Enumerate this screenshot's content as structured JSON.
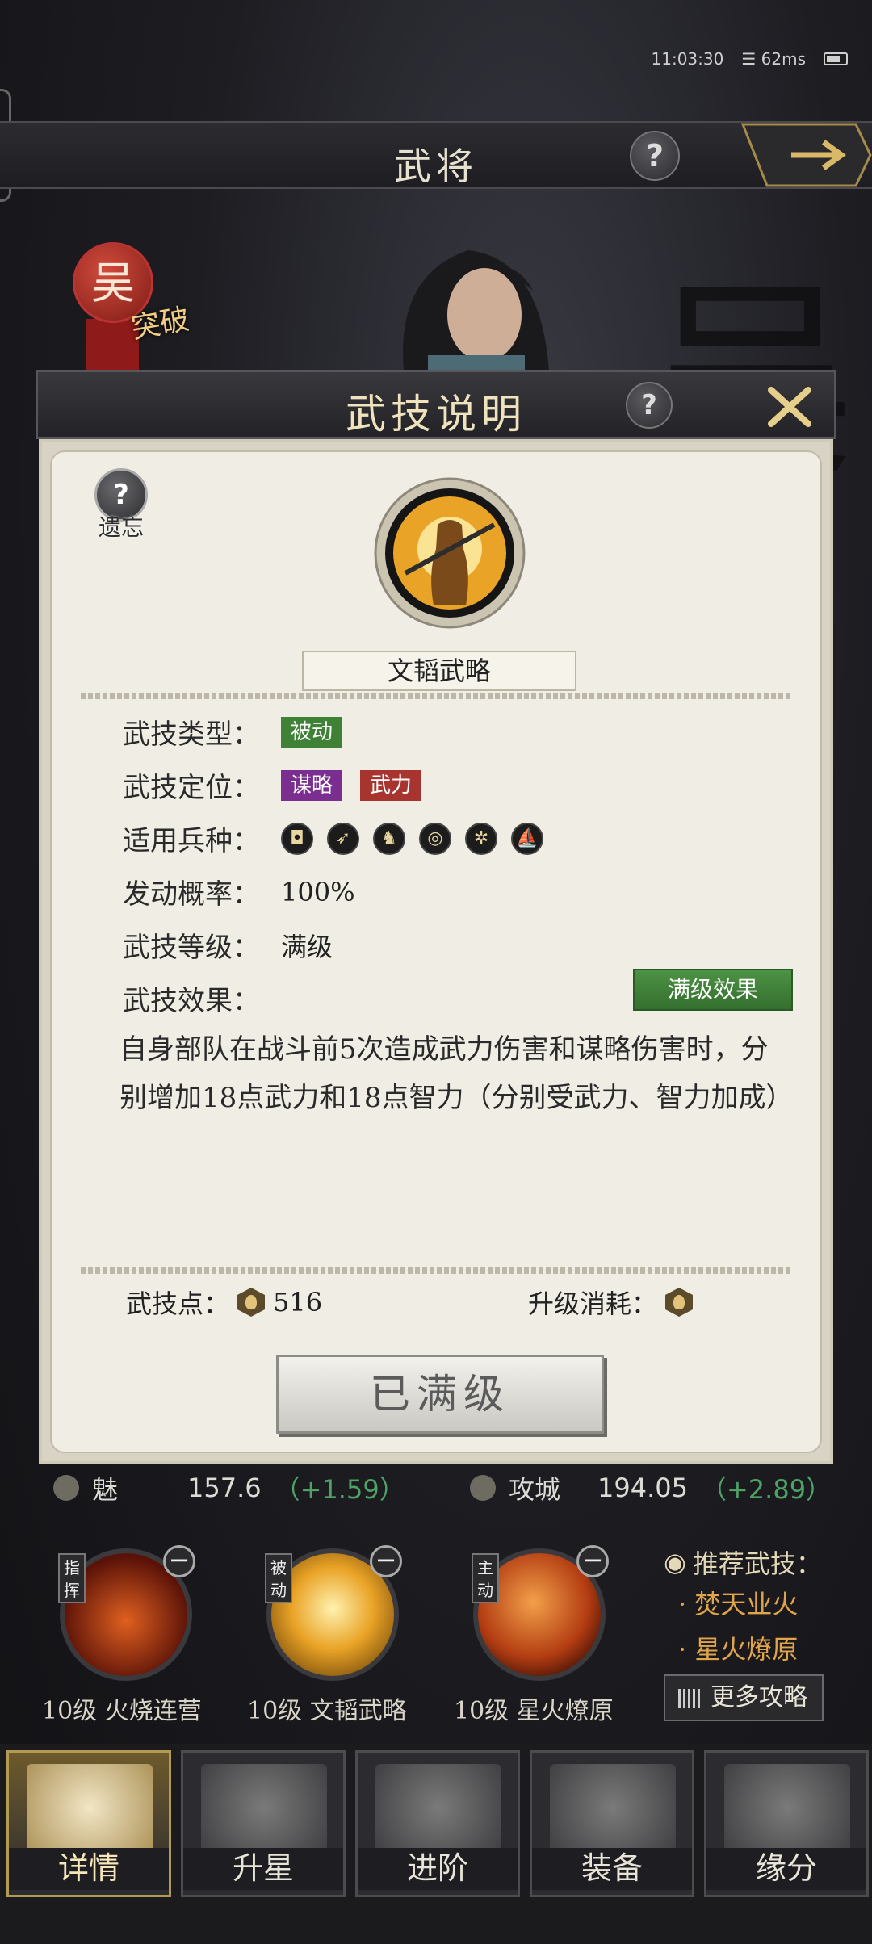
{
  "status": {
    "time": "11:03:30",
    "ping": "62ms"
  },
  "header": {
    "title": "武将",
    "help": "?"
  },
  "faction": {
    "char": "吴",
    "tag": "突破"
  },
  "modal": {
    "title": "武技说明",
    "help": "?",
    "forget": {
      "icon": "?",
      "label": "遗忘"
    },
    "skill_name": "文韬武略",
    "rows": {
      "type_label": "武技类型：",
      "type_tag": "被动",
      "role_label": "武技定位：",
      "role_tags": [
        "谋略",
        "武力"
      ],
      "units_label": "适用兵种：",
      "units": [
        "shield-icon",
        "spear-icon",
        "cavalry-icon",
        "bow-icon",
        "wheel-icon",
        "ship-icon"
      ],
      "prob_label": "发动概率：",
      "prob_value": "100%",
      "level_label": "武技等级：",
      "level_value": "满级",
      "effect_label": "武技效果："
    },
    "max_effect_button": "满级效果",
    "description": "自身部队在战斗前5次造成武力伤害和谋略伤害时，分别增加18点武力和18点智力（分别受武力、智力加成）",
    "points_label": "武技点：",
    "points_value": "516",
    "upgrade_cost_label": "升级消耗：",
    "done_button": "已满级"
  },
  "stats": [
    {
      "label": "魅",
      "value": "157.6",
      "delta": "（+1.59）"
    },
    {
      "label": "攻城",
      "value": "194.05",
      "delta": "（+2.89）"
    }
  ],
  "skills": [
    {
      "type": "指挥",
      "label": "10级 火烧连营"
    },
    {
      "type": "被动",
      "label": "10级 文韬武略"
    },
    {
      "type": "主动",
      "label": "10级 星火燎原"
    }
  ],
  "recommend": {
    "title": "推荐武技：",
    "items": [
      "· 焚天业火",
      "· 星火燎原"
    ],
    "more": "更多攻略"
  },
  "nav": [
    {
      "label": "详情",
      "active": true
    },
    {
      "label": "升星",
      "active": false
    },
    {
      "label": "进阶",
      "active": false
    },
    {
      "label": "装备",
      "active": false
    },
    {
      "label": "缘分",
      "active": false
    }
  ],
  "colors": {
    "passive_green": "#3f8237",
    "strategy_purple": "#7a2e90",
    "force_red": "#a83430",
    "positive_delta": "#4ea266",
    "recommend_orange": "#e0a44b"
  }
}
